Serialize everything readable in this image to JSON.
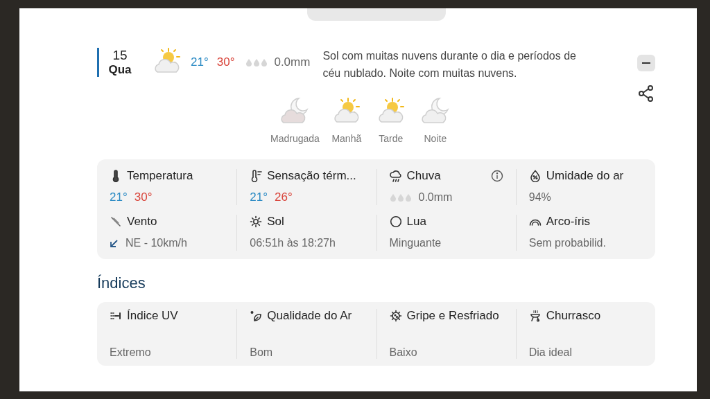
{
  "day": {
    "date": "15",
    "weekday": "Qua",
    "min": "21°",
    "max": "30°",
    "rain": "0.0mm",
    "summary": "Sol com muitas nuvens durante o dia e períodos de céu nublado. Noite com muitas nuvens."
  },
  "periods": [
    {
      "label": "Madrugada",
      "kind": "moon"
    },
    {
      "label": "Manhã",
      "kind": "sun"
    },
    {
      "label": "Tarde",
      "kind": "sun"
    },
    {
      "label": "Noite",
      "kind": "moon"
    }
  ],
  "details": [
    {
      "kind": "temps",
      "title": "Temperatura",
      "min": "21°",
      "max": "30°"
    },
    {
      "kind": "temps",
      "title": "Sensação térm...",
      "min": "21°",
      "max": "26°"
    },
    {
      "kind": "rain",
      "title": "Chuva",
      "value": "0.0mm"
    },
    {
      "kind": "text",
      "title": "Umidade do ar",
      "value": "94%"
    },
    {
      "kind": "wind",
      "title": "Vento",
      "value": "NE - 10km/h"
    },
    {
      "kind": "text",
      "title": "Sol",
      "value": "06:51h às 18:27h"
    },
    {
      "kind": "text",
      "title": "Lua",
      "value": "Minguante"
    },
    {
      "kind": "text",
      "title": "Arco-íris",
      "value": "Sem probabilid."
    }
  ],
  "indices_title": "Índices",
  "indices": [
    {
      "title": "Índice UV",
      "value": "Extremo"
    },
    {
      "title": "Qualidade do Ar",
      "value": "Bom"
    },
    {
      "title": "Gripe e Resfriado",
      "value": "Baixo"
    },
    {
      "title": "Churrasco",
      "value": "Dia ideal"
    }
  ]
}
